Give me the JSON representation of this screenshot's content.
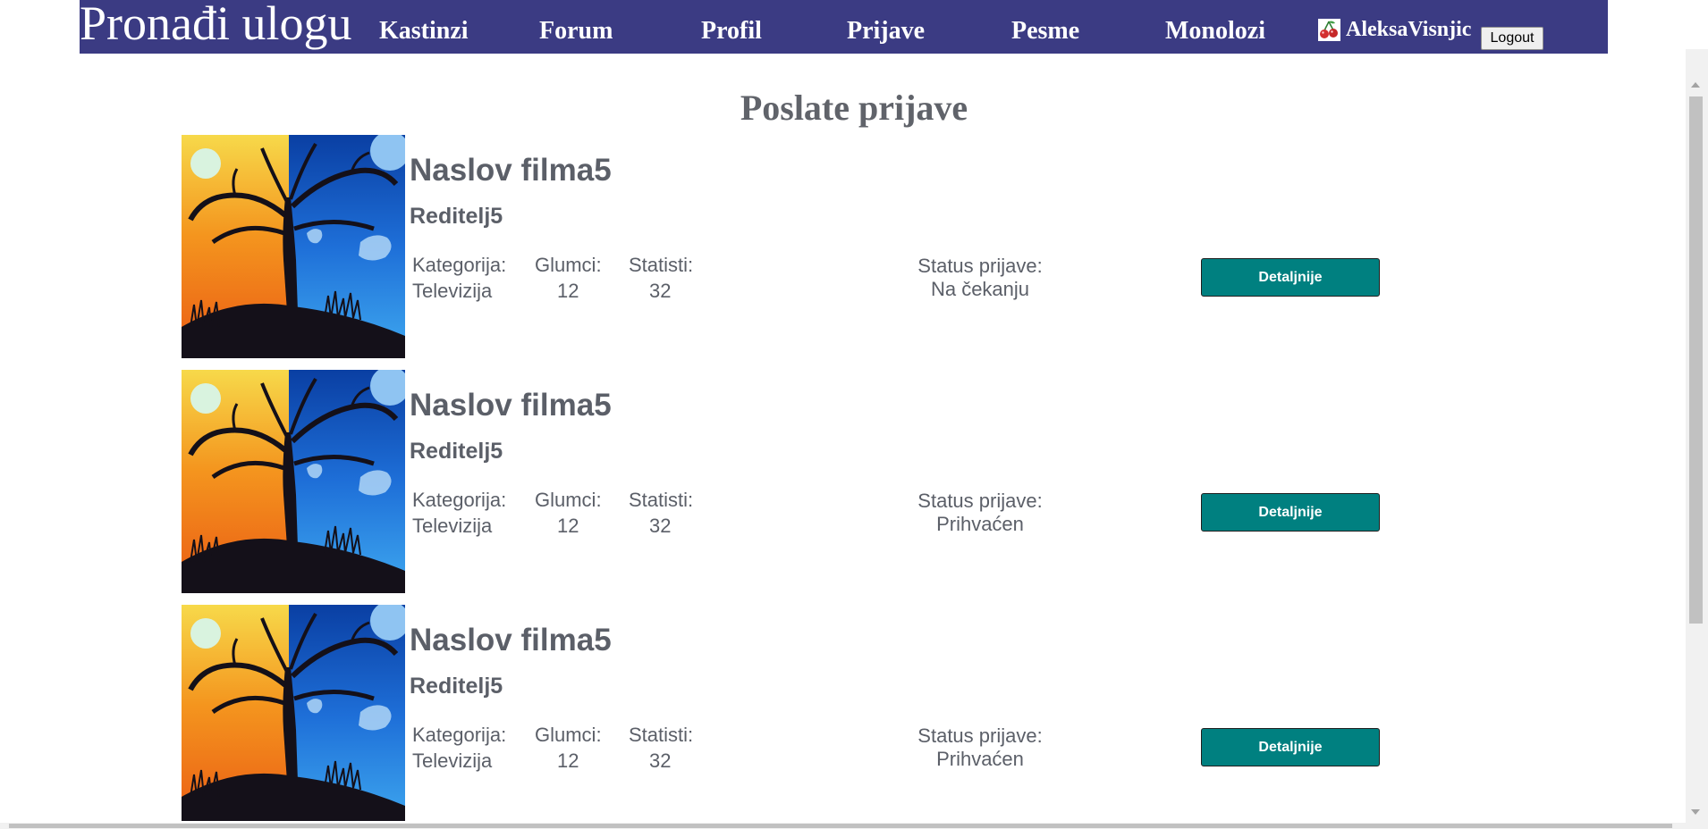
{
  "navbar": {
    "brand": "Pronađi ulogu",
    "links": [
      "Kastinzi",
      "Forum",
      "Profil",
      "Prijave",
      "Pesme",
      "Monolozi"
    ],
    "username": "AleksaVisnjic",
    "logout_label": "Logout"
  },
  "page": {
    "title": "Poslate prijave"
  },
  "labels": {
    "category": "Kategorija:",
    "actors": "Glumci:",
    "extras": "Statisti:",
    "status": "Status prijave:",
    "details_button": "Detaljnije"
  },
  "applications": [
    {
      "title": "Naslov filma5",
      "director": "Reditelj5",
      "category": "Televizija",
      "actors": "12",
      "extras": "32",
      "status": "Na čekanju"
    },
    {
      "title": "Naslov filma5",
      "director": "Reditelj5",
      "category": "Televizija",
      "actors": "12",
      "extras": "32",
      "status": "Prihvaćen"
    },
    {
      "title": "Naslov filma5",
      "director": "Reditelj5",
      "category": "Televizija",
      "actors": "12",
      "extras": "32",
      "status": "Prihvaćen"
    }
  ],
  "colors": {
    "navbar": "#3b3b83",
    "button": "#008080",
    "text": "#5b5f68"
  },
  "icons": {
    "user": "cherry-icon",
    "poster": "tree-painting-image"
  }
}
